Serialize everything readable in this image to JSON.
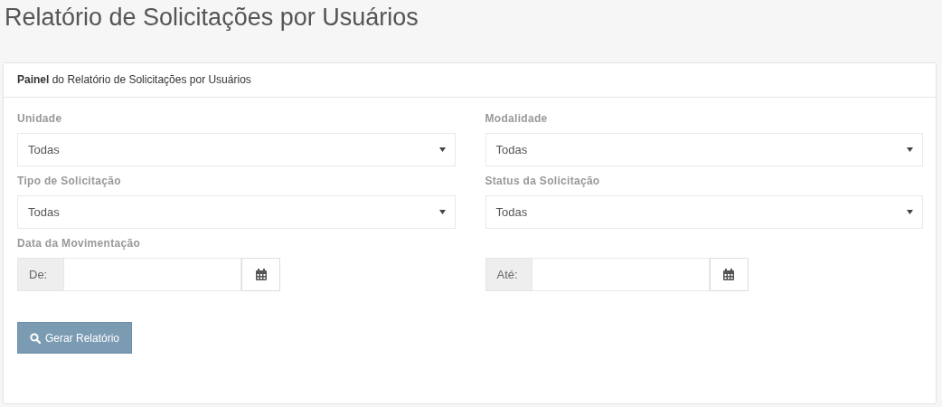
{
  "page_title": "Relatório de Solicitações por Usuários",
  "panel": {
    "heading": "**Painel** do Relatório de Solicitações por Usuários",
    "selects": [
      {
        "label": "Unidade",
        "value": "Todas"
      },
      {
        "label": "Modalidade",
        "value": "Todas"
      },
      {
        "label": "Tipo de Solicitação",
        "value": "Todas"
      },
      {
        "label": "Status da Solicitação",
        "value": "Todas"
      }
    ],
    "date_label": "Data da Movimentação",
    "date_fields": [
      {
        "addon": "De:"
      },
      {
        "addon": "Até:"
      }
    ],
    "submit_button": "Gerar Relatório"
  }
}
